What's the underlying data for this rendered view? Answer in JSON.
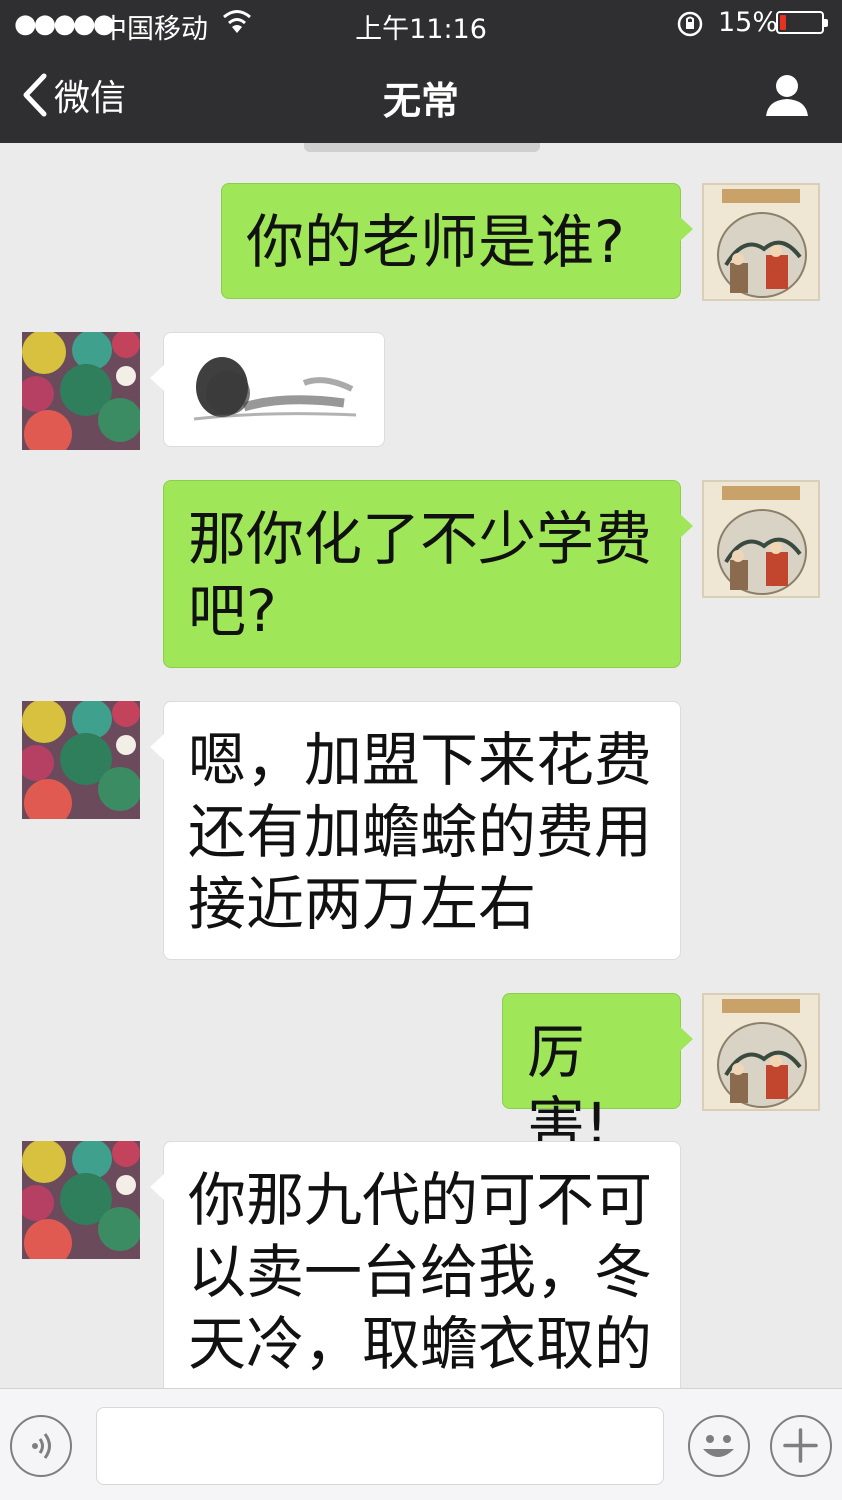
{
  "status_bar": {
    "signal": "●●●●●",
    "carrier": "中国移动",
    "time": "上午11:16",
    "battery_percent": "15%",
    "battery_level": 0.15,
    "battery_color": "#e8321f"
  },
  "nav": {
    "back_label": "微信",
    "title": "无常"
  },
  "colors": {
    "outgoing_bubble": "#9fe658",
    "incoming_bubble": "#ffffff",
    "header_bg": "#2f2f31",
    "chat_bg": "#ebebeb"
  },
  "messages": [
    {
      "sender": "me",
      "text": "你的老师是谁?"
    },
    {
      "sender": "other",
      "text": ""
    },
    {
      "sender": "me",
      "text": "那你化了不少学费\n吧?"
    },
    {
      "sender": "other",
      "text": "嗯，加盟下来花费\n还有加蟾蜍的费用\n接近两万左右"
    },
    {
      "sender": "me",
      "text": "厉害!"
    },
    {
      "sender": "other",
      "text": "你那九代的可不可\n以卖一台给我，冬\n天冷，取蟾衣取的"
    }
  ],
  "toolbar": {
    "input_value": "",
    "icons": [
      "voice-icon",
      "emoji-icon",
      "plus-icon"
    ]
  }
}
